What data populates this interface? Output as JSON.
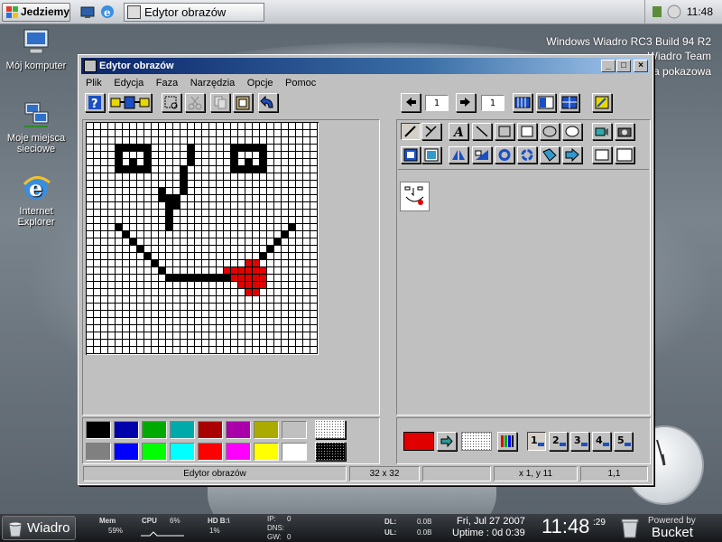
{
  "top_taskbar": {
    "start_label": "Jedziemy",
    "task_button_label": "Edytor obrazów",
    "clock": "11:48"
  },
  "desktop": {
    "brand_line1": "Windows Wiadro RC3 Build 94 R2",
    "brand_line2": "Wiadro Team",
    "brand_line3": "a pokazowa",
    "icons": [
      {
        "label": "Mój komputer",
        "icon": "computer-icon"
      },
      {
        "label": "Moje miejsca sieciowe",
        "icon": "network-places-icon"
      },
      {
        "label": "Internet Explorer",
        "icon": "internet-explorer-icon"
      }
    ]
  },
  "window": {
    "title": "Edytor obrazów",
    "menu": [
      "Plik",
      "Edycja",
      "Faza",
      "Narzędzia",
      "Opcje",
      "Pomoc"
    ],
    "frame_left_value": "1",
    "frame_right_value": "1",
    "layer_buttons": [
      "1",
      "2",
      "3",
      "4",
      "5"
    ],
    "status": {
      "app": "Edytor obrazów",
      "size": "32 x 32",
      "empty": "",
      "coords": "x  1, y 11",
      "zoom": "1,1"
    }
  },
  "colors": {
    "accent_title": "#0a246a",
    "current_color": "#e00000",
    "palette_row1": [
      "#000000",
      "#0000aa",
      "#00aa00",
      "#00aaaa",
      "#aa0000",
      "#aa00aa",
      "#aaaa00",
      "#c0c0c0"
    ],
    "palette_row2": [
      "#808080",
      "#0000ff",
      "#00ff00",
      "#00ffff",
      "#ff0000",
      "#ff00ff",
      "#ffff00",
      "#ffffff"
    ]
  },
  "canvas": {
    "width": 32,
    "height": 32,
    "black_rows": [
      "",
      "",
      "",
      "4-8,14,20-24",
      "4,8,14,20,24",
      "4,6,8,14,20,22,24",
      "4-8,13,20-24",
      "13",
      "13",
      "10,13",
      "10-12",
      "11-12",
      "11",
      "11",
      "4,11,28",
      "5,27",
      "6,26",
      "7,25",
      "8,24",
      "9,23",
      "10",
      "11,12,13,14,15,16,17,18,19,20,21"
    ],
    "red_rows": [
      "",
      "",
      "",
      "",
      "",
      "",
      "",
      "",
      "",
      "",
      "",
      "",
      "",
      "",
      "",
      "",
      "",
      "",
      "",
      "22-23",
      "19-24",
      "20-24",
      "21-24",
      "22-23"
    ]
  },
  "bottom_taskbar": {
    "start_label": "Wiadro",
    "mem_label": "Mem",
    "mem_value": "59%",
    "cpu_label": "CPU",
    "cpu_value": "6%",
    "hd_label": "HD B:\\",
    "hd_value": "1%",
    "ip_label": "IP:",
    "ip_value": "0",
    "dns_label": "DNS:",
    "gw_label": "GW:",
    "gw_value": "0",
    "dl_label": "DL:",
    "dl_value": "0.0B",
    "ul_label": "UL:",
    "ul_value": "0.0B",
    "date": "Fri, Jul 27 2007",
    "uptime": "Uptime : 0d 0:39",
    "big_time": "11:48",
    "seconds": ":29",
    "powered_by": "Powered by",
    "bucket": "Bucket"
  }
}
